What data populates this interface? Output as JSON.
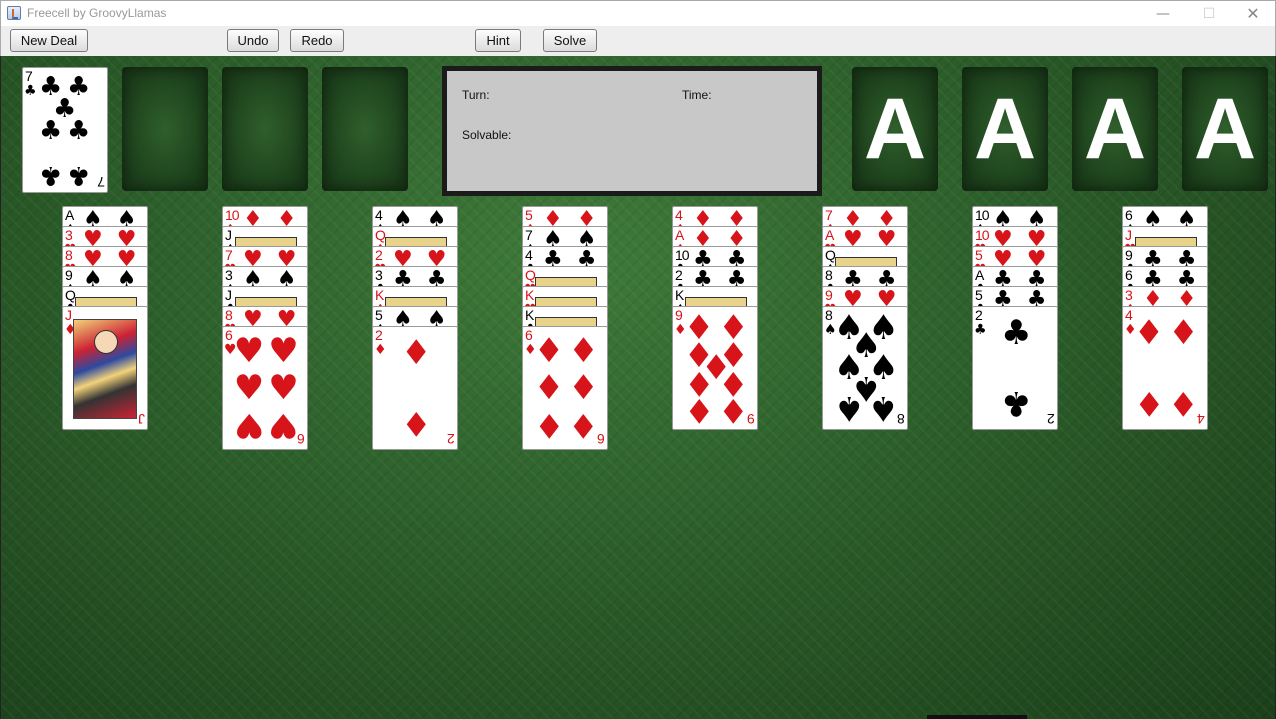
{
  "window": {
    "title": "Freecell by GroovyLlamas",
    "minimize": "—",
    "maximize": "☐",
    "close": "✕"
  },
  "toolbar": {
    "new_deal": "New Deal",
    "undo": "Undo",
    "redo": "Redo",
    "hint": "Hint",
    "solve": "Solve"
  },
  "info": {
    "turn_label": "Turn:",
    "time_label": "Time:",
    "solvable_label": "Solvable:"
  },
  "free_cells": [
    {
      "rank": "7",
      "suit": "♣",
      "color": "black"
    },
    null,
    null,
    null
  ],
  "foundations": [
    "A",
    "A",
    "A",
    "A"
  ],
  "columns": [
    [
      {
        "rank": "A",
        "suit": "♠",
        "color": "black"
      },
      {
        "rank": "3",
        "suit": "♥",
        "color": "red"
      },
      {
        "rank": "8",
        "suit": "♥",
        "color": "red"
      },
      {
        "rank": "9",
        "suit": "♠",
        "color": "black"
      },
      {
        "rank": "Q",
        "suit": "♣",
        "color": "black",
        "face": true
      },
      {
        "rank": "J",
        "suit": "♦",
        "color": "red",
        "face": true
      }
    ],
    [
      {
        "rank": "10",
        "suit": "♦",
        "color": "red"
      },
      {
        "rank": "J",
        "suit": "♠",
        "color": "black",
        "face": true
      },
      {
        "rank": "7",
        "suit": "♥",
        "color": "red"
      },
      {
        "rank": "3",
        "suit": "♠",
        "color": "black"
      },
      {
        "rank": "J",
        "suit": "♣",
        "color": "black",
        "face": true
      },
      {
        "rank": "8",
        "suit": "♥",
        "color": "red"
      },
      {
        "rank": "6",
        "suit": "♥",
        "color": "red"
      }
    ],
    [
      {
        "rank": "4",
        "suit": "♠",
        "color": "black"
      },
      {
        "rank": "Q",
        "suit": "♦",
        "color": "red",
        "face": true
      },
      {
        "rank": "2",
        "suit": "♥",
        "color": "red"
      },
      {
        "rank": "3",
        "suit": "♣",
        "color": "black"
      },
      {
        "rank": "K",
        "suit": "♦",
        "color": "red",
        "face": true
      },
      {
        "rank": "5",
        "suit": "♠",
        "color": "black"
      },
      {
        "rank": "2",
        "suit": "♦",
        "color": "red"
      }
    ],
    [
      {
        "rank": "5",
        "suit": "♦",
        "color": "red"
      },
      {
        "rank": "7",
        "suit": "♠",
        "color": "black"
      },
      {
        "rank": "4",
        "suit": "♣",
        "color": "black"
      },
      {
        "rank": "Q",
        "suit": "♥",
        "color": "red",
        "face": true
      },
      {
        "rank": "K",
        "suit": "♥",
        "color": "red",
        "face": true
      },
      {
        "rank": "K",
        "suit": "♣",
        "color": "black",
        "face": true
      },
      {
        "rank": "6",
        "suit": "♦",
        "color": "red"
      }
    ],
    [
      {
        "rank": "4",
        "suit": "♦",
        "color": "red"
      },
      {
        "rank": "A",
        "suit": "♦",
        "color": "red"
      },
      {
        "rank": "10",
        "suit": "♣",
        "color": "black"
      },
      {
        "rank": "2",
        "suit": "♣",
        "color": "black"
      },
      {
        "rank": "K",
        "suit": "♠",
        "color": "black",
        "face": true
      },
      {
        "rank": "9",
        "suit": "♦",
        "color": "red"
      }
    ],
    [
      {
        "rank": "7",
        "suit": "♦",
        "color": "red"
      },
      {
        "rank": "A",
        "suit": "♥",
        "color": "red"
      },
      {
        "rank": "Q",
        "suit": "♠",
        "color": "black",
        "face": true
      },
      {
        "rank": "8",
        "suit": "♣",
        "color": "black"
      },
      {
        "rank": "9",
        "suit": "♥",
        "color": "red"
      },
      {
        "rank": "8",
        "suit": "♠",
        "color": "black"
      }
    ],
    [
      {
        "rank": "10",
        "suit": "♠",
        "color": "black"
      },
      {
        "rank": "10",
        "suit": "♥",
        "color": "red"
      },
      {
        "rank": "5",
        "suit": "♥",
        "color": "red"
      },
      {
        "rank": "A",
        "suit": "♣",
        "color": "black"
      },
      {
        "rank": "5",
        "suit": "♣",
        "color": "black"
      },
      {
        "rank": "2",
        "suit": "♣",
        "color": "black"
      }
    ],
    [
      {
        "rank": "6",
        "suit": "♠",
        "color": "black"
      },
      {
        "rank": "J",
        "suit": "♥",
        "color": "red",
        "face": true
      },
      {
        "rank": "9",
        "suit": "♣",
        "color": "black"
      },
      {
        "rank": "6",
        "suit": "♣",
        "color": "black"
      },
      {
        "rank": "3",
        "suit": "♦",
        "color": "red"
      },
      {
        "rank": "4",
        "suit": "♦",
        "color": "red"
      }
    ]
  ],
  "colors": {
    "felt": "#2c5e2a",
    "info_panel": "#c8c8c8",
    "red_suit": "#d7141a"
  }
}
